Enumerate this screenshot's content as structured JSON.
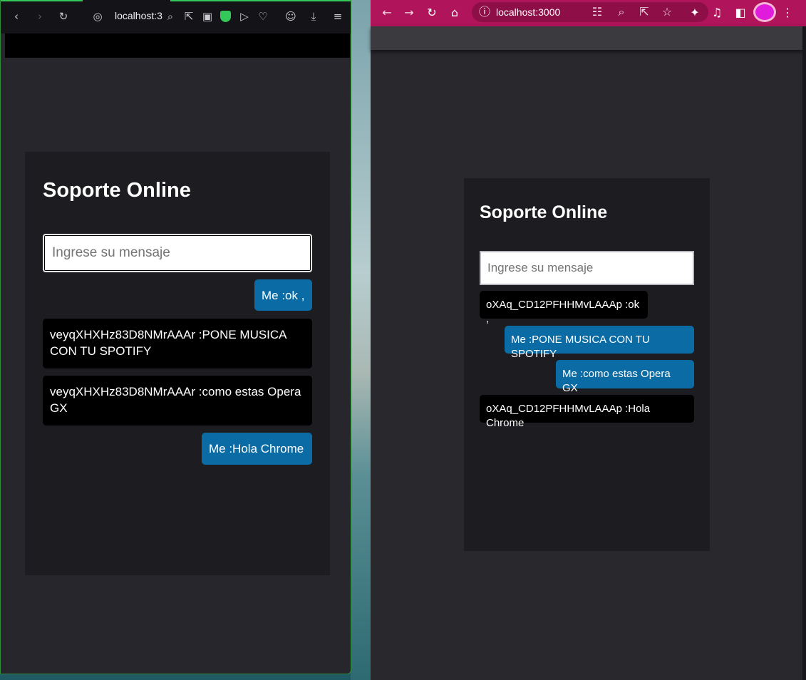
{
  "opera": {
    "address": "localhost:3",
    "title": "Soporte Online",
    "input_placeholder": "Ingrese su mensaje",
    "messages": [
      {
        "text": "Me :ok ,",
        "from": "me"
      },
      {
        "text": "veyqXHXHz83D8NMrAAAr :PONE MUSICA CON TU SPOTIFY",
        "from": "other"
      },
      {
        "text": "veyqXHXHz83D8NMrAAAr :como estas Opera GX",
        "from": "other"
      },
      {
        "text": "Me :Hola Chrome",
        "from": "me"
      }
    ]
  },
  "chrome": {
    "address": "localhost:3000",
    "title": "Soporte Online",
    "input_placeholder": "Ingrese su mensaje",
    "messages": [
      {
        "text": "oXAq_CD12PFHHMvLAAAp :ok ,",
        "from": "other"
      },
      {
        "text": "Me :PONE MUSICA CON TU SPOTIFY",
        "from": "me"
      },
      {
        "text": "Me :como estas Opera GX",
        "from": "me"
      },
      {
        "text": "oXAq_CD12PFHHMvLAAAp :Hola Chrome",
        "from": "other"
      }
    ]
  },
  "colors": {
    "me_bubble": "#0b6ba4",
    "other_bubble": "#000000",
    "card_bg": "#1c1c21",
    "page_bg": "#26262c",
    "chrome_toolbar": "#b0145a"
  },
  "icons": {
    "opera_toolbar": [
      "back-icon",
      "forward-icon",
      "reload-icon",
      "globe-icon",
      "zoom-icon",
      "share-icon",
      "camera-icon",
      "shield-icon",
      "send-icon",
      "heart-icon",
      "profile-icon",
      "download-icon",
      "menu-icon"
    ],
    "chrome_toolbar": [
      "back-icon",
      "forward-icon",
      "reload-icon",
      "home-icon",
      "info-icon",
      "translate-icon",
      "zoom-icon",
      "share-icon",
      "star-icon",
      "extensions-icon",
      "media-icon",
      "sidepanel-icon",
      "profile-avatar",
      "kebab-menu-icon"
    ]
  }
}
